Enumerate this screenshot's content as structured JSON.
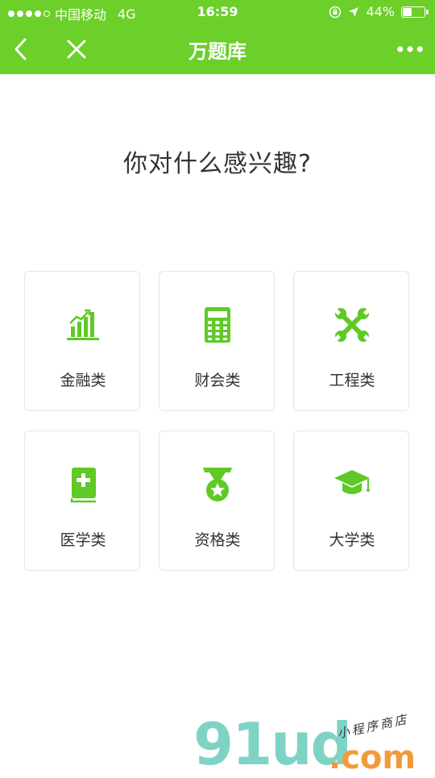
{
  "status_bar": {
    "carrier": "中国移动",
    "network": "4G",
    "time": "16:59",
    "battery_text": "44%",
    "battery_level": 0.44
  },
  "nav": {
    "title": "万题库"
  },
  "prompt": "你对什么感兴趣?",
  "categories": [
    {
      "label": "金融类",
      "icon": "bar-chart-icon"
    },
    {
      "label": "财会类",
      "icon": "calculator-icon"
    },
    {
      "label": "工程类",
      "icon": "wrench-cross-icon"
    },
    {
      "label": "医学类",
      "icon": "medical-book-icon"
    },
    {
      "label": "资格类",
      "icon": "medal-icon"
    },
    {
      "label": "大学类",
      "icon": "graduation-cap-icon"
    }
  ],
  "watermark": {
    "brand": "91ud",
    "domain": ".com",
    "tagline": "小程序商店"
  },
  "colors": {
    "accent": "#6ccf2a",
    "icon_green": "#5fc925"
  }
}
